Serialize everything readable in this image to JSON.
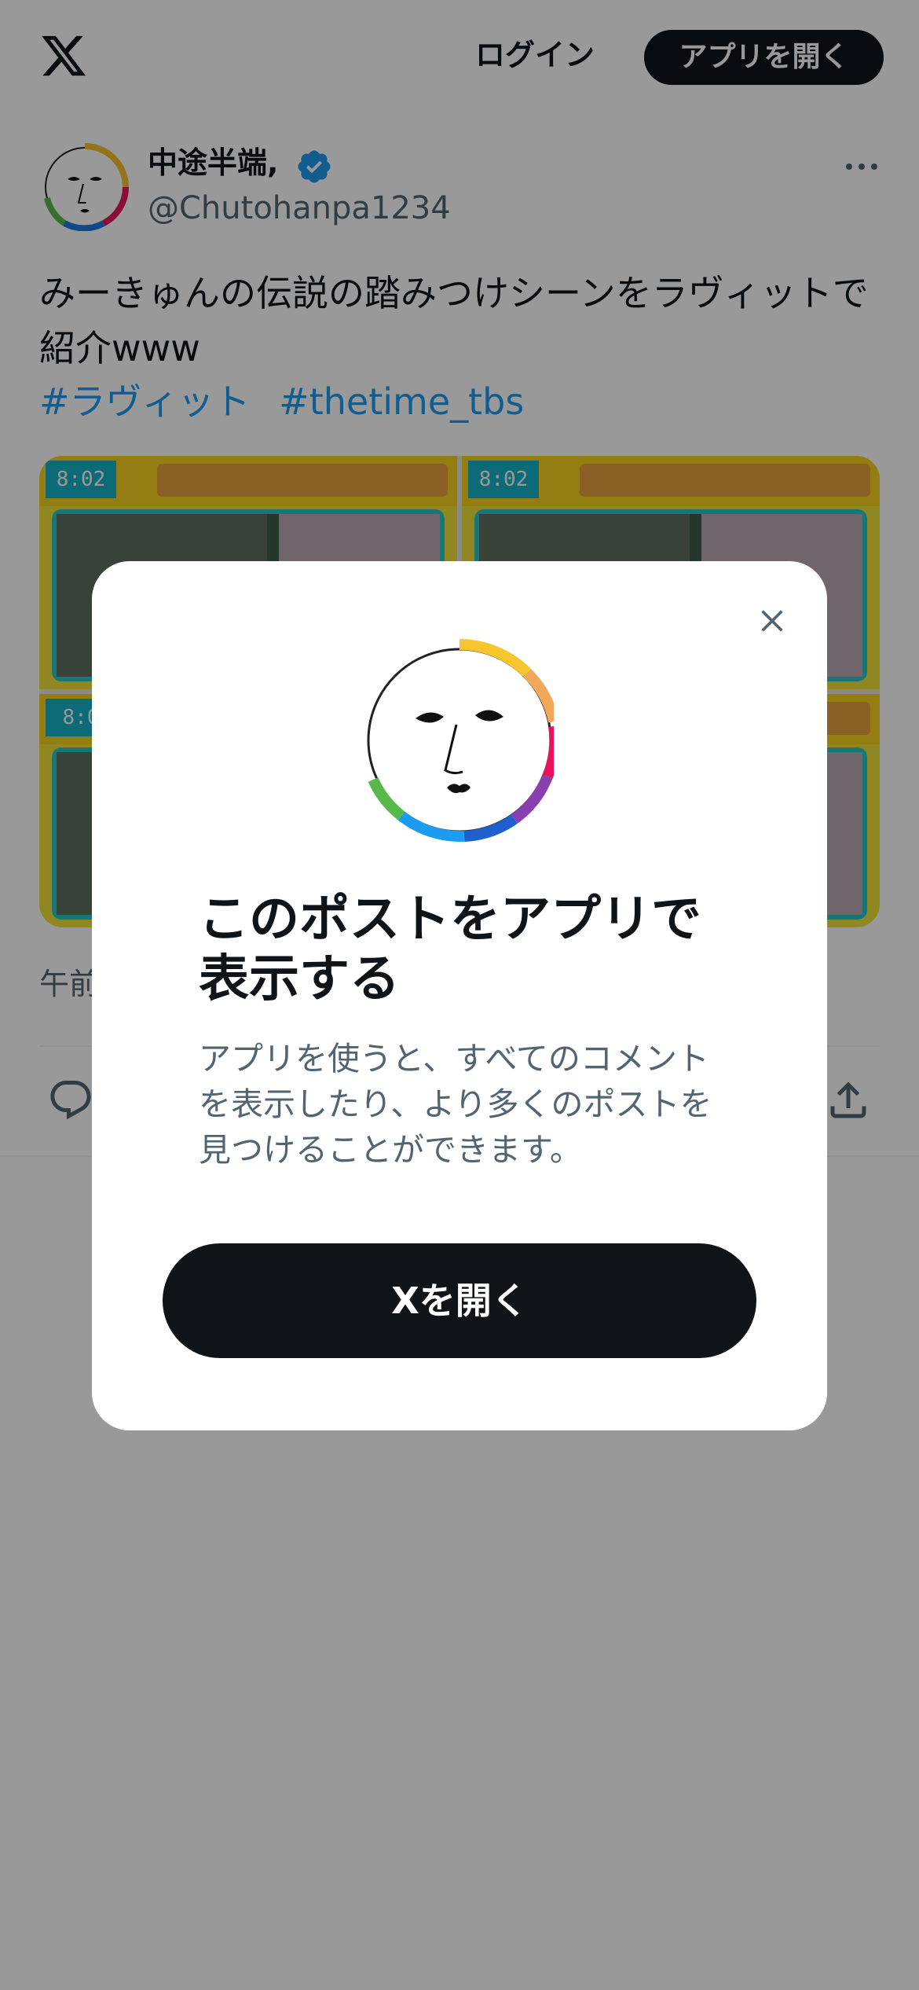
{
  "header": {
    "logo_icon": "x-logo-icon",
    "login_label": "ログイン",
    "open_app_label": "アプリを開く"
  },
  "post": {
    "author_name": "中途半端,",
    "verified_icon": "verified-badge-icon",
    "author_handle": "@Chutohanpa1234",
    "text": "みーきゅんの伝説の踏みつけシーンをラヴィットで紹介www",
    "hashtags": [
      "#ラヴィット",
      "#thetime_tbs"
    ],
    "media": [
      {
        "clock": "8:02"
      },
      {
        "clock": "8:02"
      },
      {
        "clock": "8:0"
      },
      {
        "clock": ""
      }
    ],
    "timestamp": "午前",
    "actions": {
      "reply_icon": "reply-icon",
      "share_icon": "share-icon"
    }
  },
  "modal": {
    "close_icon": "close-icon",
    "title": "このポストをアプリで表示する",
    "description": "アプリを使うと、すべてのコメントを表示したり、より多くのポストを見つけることができます。",
    "cta_label": "Xを開く"
  },
  "colors": {
    "overlay": "#000000",
    "primary_text": "#0f1419",
    "secondary_text": "#536471",
    "link": "#1d9bf0",
    "button_dark": "#0f1419",
    "verified": "#1d9bf0"
  }
}
